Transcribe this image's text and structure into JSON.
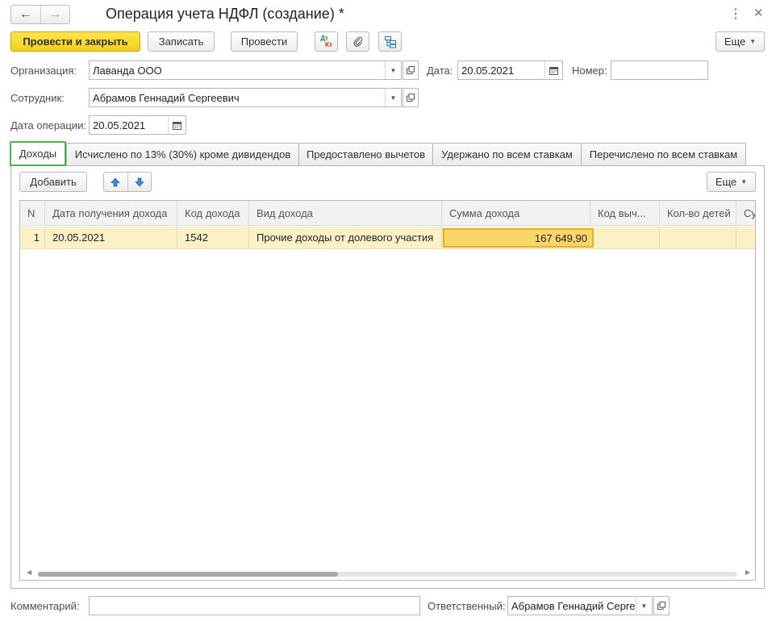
{
  "window": {
    "title": "Операция учета НДФЛ (создание) *",
    "more_glyph": "⋮",
    "close_glyph": "✕"
  },
  "nav": {
    "back_glyph": "←",
    "forward_glyph": "→"
  },
  "toolbar": {
    "post_close_label": "Провести и закрыть",
    "save_label": "Записать",
    "post_label": "Провести",
    "dtkt_top": "Дт",
    "dtkt_bottom": "Кт",
    "more_label": "Еще"
  },
  "form": {
    "org_label": "Организация:",
    "org_value": "Лаванда ООО",
    "date_label": "Дата:",
    "date_value": "20.05.2021",
    "number_label": "Номер:",
    "number_value": "",
    "employee_label": "Сотрудник:",
    "employee_value": "Абрамов Геннадий Сергеевич",
    "op_date_label": "Дата операции:",
    "op_date_value": "20.05.2021"
  },
  "tabs": [
    {
      "label": "Доходы"
    },
    {
      "label": "Исчислено по 13% (30%) кроме дивидендов"
    },
    {
      "label": "Предоставлено вычетов"
    },
    {
      "label": "Удержано по всем ставкам"
    },
    {
      "label": "Перечислено по всем ставкам"
    }
  ],
  "table_toolbar": {
    "add_label": "Добавить",
    "up_icon": "arrow-up-icon",
    "down_icon": "arrow-down-icon",
    "more_label": "Еще"
  },
  "table": {
    "columns": [
      "N",
      "Дата получения дохода",
      "Код дохода",
      "Вид дохода",
      "Сумма дохода",
      "Код выч...",
      "Кол-во детей",
      "Су"
    ],
    "rows": [
      [
        "1",
        "20.05.2021",
        "1542",
        "Прочие доходы от долевого участия",
        "167 649,90",
        "",
        "",
        ""
      ]
    ]
  },
  "footer": {
    "comment_label": "Комментарий:",
    "comment_value": "",
    "responsible_label": "Ответственный:",
    "responsible_value": "Абрамов Геннадий Сергеевич"
  },
  "colors": {
    "primary_button": "#f4cf1f",
    "active_tab_border": "#4caf50",
    "selected_row": "#fbf0c6",
    "selected_cell": "#f9d66a"
  }
}
